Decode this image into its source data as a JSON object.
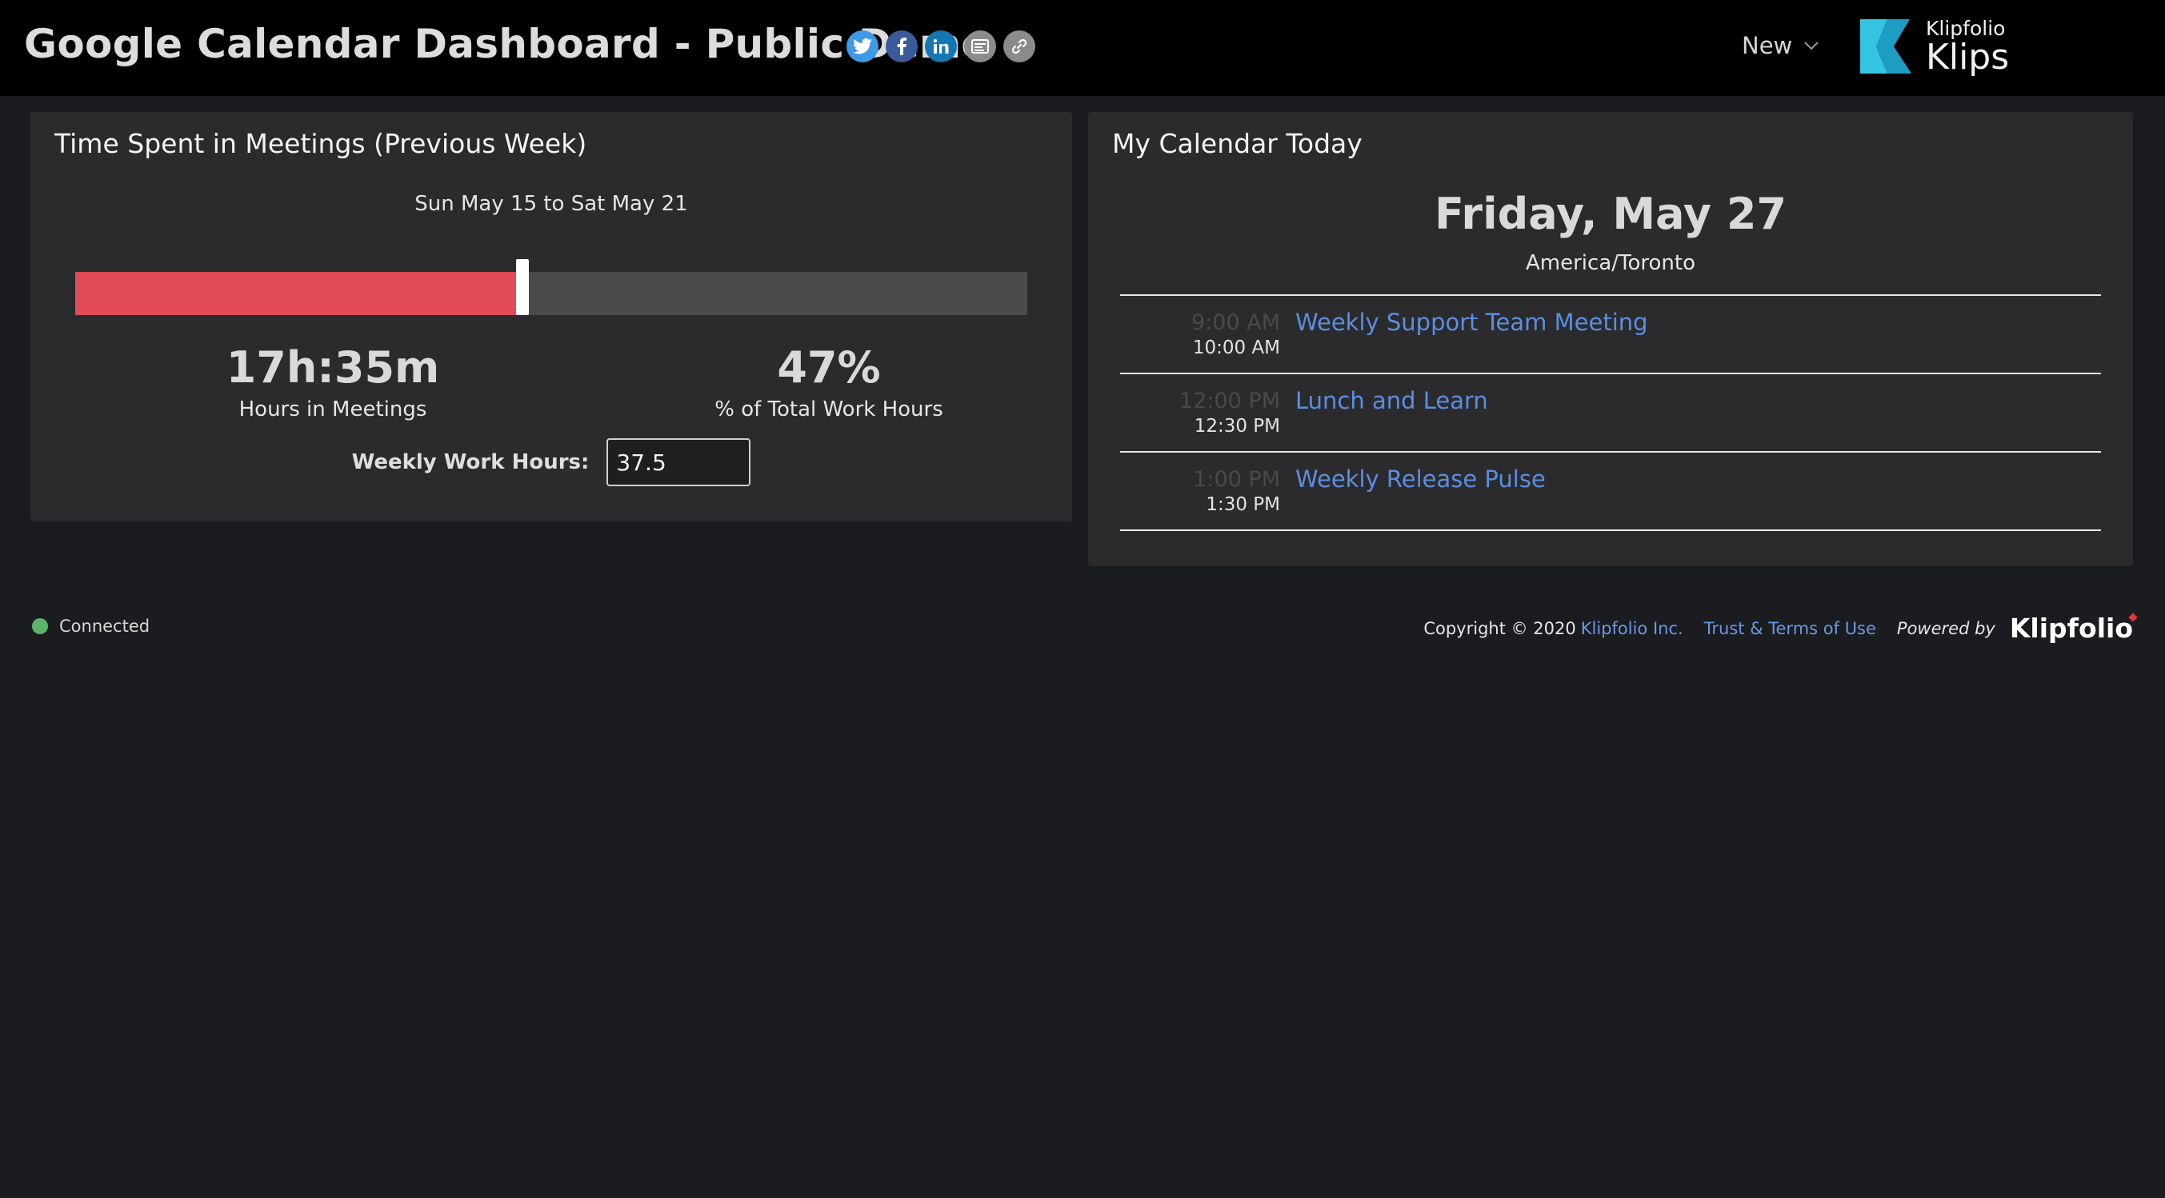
{
  "header": {
    "title": "Google Calendar Dashboard - Public Demo",
    "share_buttons": [
      {
        "name": "twitter-icon"
      },
      {
        "name": "facebook-icon"
      },
      {
        "name": "linkedin-icon"
      },
      {
        "name": "embed-icon"
      },
      {
        "name": "link-icon"
      }
    ],
    "new_menu_label": "New",
    "logo": {
      "small": "Klipfolio",
      "big": "Klips",
      "colors": [
        "#36c6e6",
        "#1a8fb8"
      ]
    }
  },
  "meetings_panel": {
    "title": "Time Spent in Meetings (Previous Week)",
    "date_range": "Sun May 15 to Sat May 21",
    "progress_percent": 47,
    "fill_color": "#e04b57",
    "hours_value": "17h:35m",
    "hours_label": "Hours in Meetings",
    "percent_value": "47%",
    "percent_label": "% of Total Work Hours",
    "work_hours_label": "Weekly Work Hours:",
    "work_hours_value": "37.5"
  },
  "calendar_panel": {
    "title": "My Calendar Today",
    "day": "Friday, May 27",
    "timezone": "America/Toronto",
    "events": [
      {
        "start": "9:00 AM",
        "end": "10:00 AM",
        "title": "Weekly Support Team Meeting"
      },
      {
        "start": "12:00 PM",
        "end": "12:30 PM",
        "title": "Lunch and Learn"
      },
      {
        "start": "1:00 PM",
        "end": "1:30 PM",
        "title": "Weekly Release Pulse"
      }
    ]
  },
  "footer": {
    "status": "Connected",
    "status_color": "#5cb36a",
    "copyright": "Copyright © 2020",
    "company": "Klipfolio Inc.",
    "terms": "Trust & Terms of Use",
    "powered_by": "Powered by",
    "brand": "Klipfolio"
  }
}
